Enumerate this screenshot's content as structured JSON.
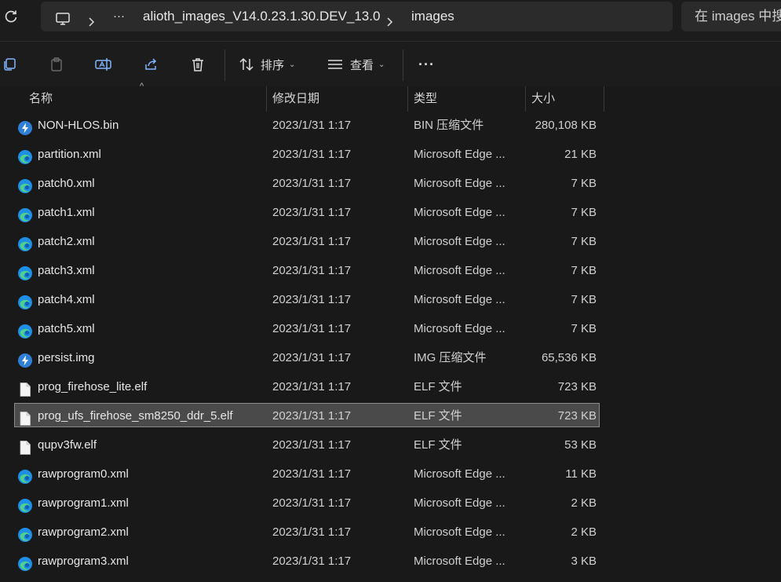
{
  "address": {
    "overflow": "···",
    "folder": "alioth_images_V14.0.23.1.30.DEV_13.0",
    "current": "images",
    "search_placeholder": "在 images 中搜索"
  },
  "toolbar": {
    "sort_label": "排序",
    "view_label": "查看",
    "more_label": "···"
  },
  "columns": {
    "name": "名称",
    "date": "修改日期",
    "type": "类型",
    "size": "大小"
  },
  "rows": [
    {
      "name": "NON-HLOS.bin",
      "date": "2023/1/31 1:17",
      "type": "BIN 压缩文件",
      "size": "280,108 KB",
      "icon": "archive-icon"
    },
    {
      "name": "partition.xml",
      "date": "2023/1/31 1:17",
      "type": "Microsoft Edge ...",
      "size": "21 KB",
      "icon": "edge-icon"
    },
    {
      "name": "patch0.xml",
      "date": "2023/1/31 1:17",
      "type": "Microsoft Edge ...",
      "size": "7 KB",
      "icon": "edge-icon"
    },
    {
      "name": "patch1.xml",
      "date": "2023/1/31 1:17",
      "type": "Microsoft Edge ...",
      "size": "7 KB",
      "icon": "edge-icon"
    },
    {
      "name": "patch2.xml",
      "date": "2023/1/31 1:17",
      "type": "Microsoft Edge ...",
      "size": "7 KB",
      "icon": "edge-icon"
    },
    {
      "name": "patch3.xml",
      "date": "2023/1/31 1:17",
      "type": "Microsoft Edge ...",
      "size": "7 KB",
      "icon": "edge-icon"
    },
    {
      "name": "patch4.xml",
      "date": "2023/1/31 1:17",
      "type": "Microsoft Edge ...",
      "size": "7 KB",
      "icon": "edge-icon"
    },
    {
      "name": "patch5.xml",
      "date": "2023/1/31 1:17",
      "type": "Microsoft Edge ...",
      "size": "7 KB",
      "icon": "edge-icon"
    },
    {
      "name": "persist.img",
      "date": "2023/1/31 1:17",
      "type": "IMG 压缩文件",
      "size": "65,536 KB",
      "icon": "archive-icon"
    },
    {
      "name": "prog_firehose_lite.elf",
      "date": "2023/1/31 1:17",
      "type": "ELF 文件",
      "size": "723 KB",
      "icon": "file-icon"
    },
    {
      "name": "prog_ufs_firehose_sm8250_ddr_5.elf",
      "date": "2023/1/31 1:17",
      "type": "ELF 文件",
      "size": "723 KB",
      "icon": "file-icon",
      "selected": true
    },
    {
      "name": "qupv3fw.elf",
      "date": "2023/1/31 1:17",
      "type": "ELF 文件",
      "size": "53 KB",
      "icon": "file-icon"
    },
    {
      "name": "rawprogram0.xml",
      "date": "2023/1/31 1:17",
      "type": "Microsoft Edge ...",
      "size": "11 KB",
      "icon": "edge-icon"
    },
    {
      "name": "rawprogram1.xml",
      "date": "2023/1/31 1:17",
      "type": "Microsoft Edge ...",
      "size": "2 KB",
      "icon": "edge-icon"
    },
    {
      "name": "rawprogram2.xml",
      "date": "2023/1/31 1:17",
      "type": "Microsoft Edge ...",
      "size": "2 KB",
      "icon": "edge-icon"
    },
    {
      "name": "rawprogram3.xml",
      "date": "2023/1/31 1:17",
      "type": "Microsoft Edge ...",
      "size": "3 KB",
      "icon": "edge-icon"
    }
  ],
  "colors": {
    "background": "#191919",
    "selection": "#4a4a4a",
    "text": "#e6e6e6"
  }
}
